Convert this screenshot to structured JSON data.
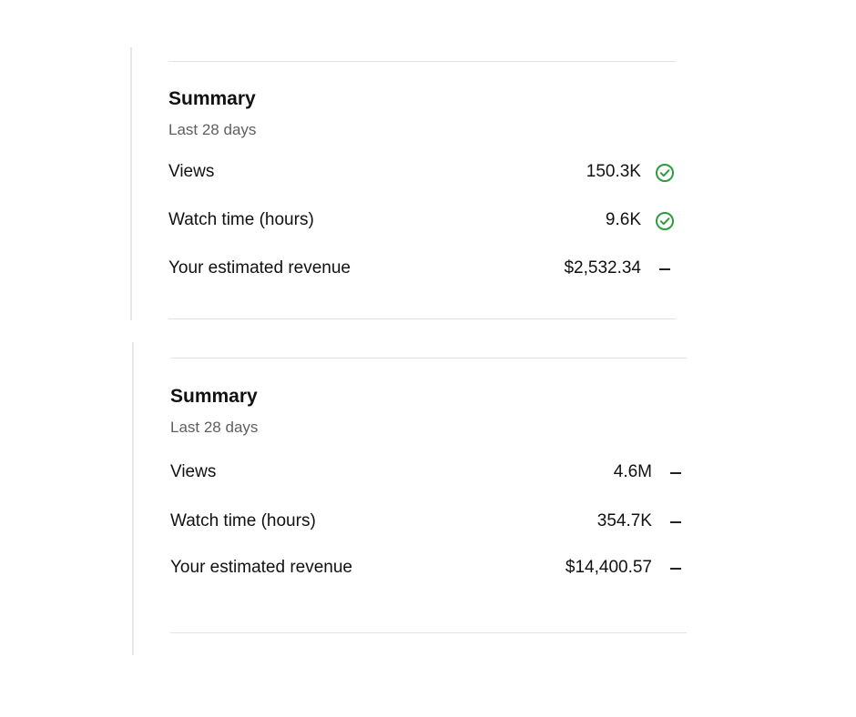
{
  "cards": [
    {
      "title": "Summary",
      "subtitle": "Last 28 days",
      "rows": [
        {
          "label": "Views",
          "value": "150.3K",
          "status": "check-circle-icon"
        },
        {
          "label": "Watch time (hours)",
          "value": "9.6K",
          "status": "check-circle-icon"
        },
        {
          "label": "Your estimated revenue",
          "value": "$2,532.34",
          "status": "dash-icon"
        }
      ]
    },
    {
      "title": "Summary",
      "subtitle": "Last 28 days",
      "rows": [
        {
          "label": "Views",
          "value": "4.6M",
          "status": "dash-icon"
        },
        {
          "label": "Watch time (hours)",
          "value": "354.7K",
          "status": "dash-icon"
        },
        {
          "label": "Your estimated revenue",
          "value": "$14,400.57",
          "status": "dash-icon"
        }
      ]
    }
  ],
  "colors": {
    "check": "#2e9c3e",
    "dash": "#222222",
    "divider": "#e3e3e3",
    "panel_border": "#e8e8e8"
  }
}
